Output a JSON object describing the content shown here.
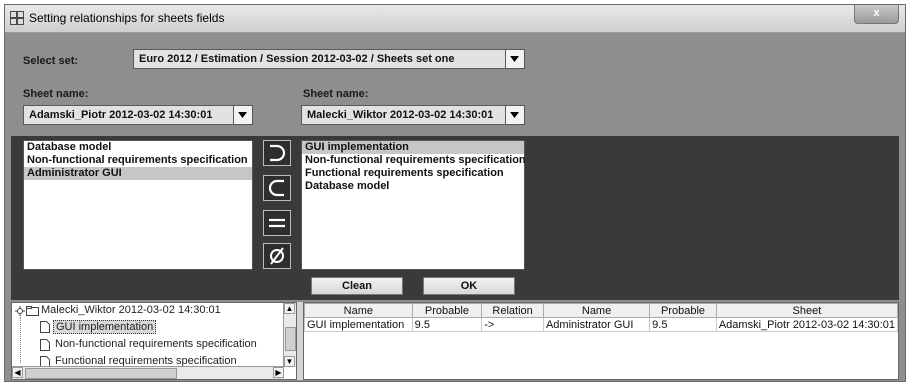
{
  "window": {
    "title": "Setting relationships for sheets fields",
    "close_label": "x"
  },
  "select_set": {
    "label": "Select set:",
    "value": "Euro 2012 / Estimation / Session 2012-03-02 / Sheets set one"
  },
  "left_sheet": {
    "label": "Sheet name:",
    "value": "Adamski_Piotr 2012-03-02 14:30:01"
  },
  "right_sheet": {
    "label": "Sheet name:",
    "value": "Malecki_Wiktor 2012-03-02 14:30:01"
  },
  "left_list": {
    "items": [
      "Database model",
      "Non-functional requirements specification",
      "Administrator GUI"
    ],
    "selected_index": 2
  },
  "right_list": {
    "items": [
      "GUI implementation",
      "Non-functional requirements specification",
      "Functional requirements specification",
      "Database model"
    ],
    "selected_index": 0
  },
  "operators": [
    {
      "name": "superset-button",
      "symbol": "superset"
    },
    {
      "name": "subset-button",
      "symbol": "subset"
    },
    {
      "name": "equal-button",
      "symbol": "equal"
    },
    {
      "name": "empty-set-button",
      "symbol": "empty-set"
    }
  ],
  "buttons": {
    "clean": "Clean",
    "ok": "OK"
  },
  "tree": {
    "root": "Malecki_Wiktor 2012-03-02 14:30:01",
    "children": [
      "GUI implementation",
      "Non-functional requirements specification",
      "Functional requirements specification"
    ],
    "selected_index": 0
  },
  "table": {
    "headers": [
      "Name",
      "Probable",
      "Relation",
      "Name",
      "Probable",
      "Sheet"
    ],
    "rows": [
      [
        "GUI implementation",
        "9.5",
        "->",
        "Administrator GUI",
        "9.5",
        "Adamski_Piotr 2012-03-02 14:30:01"
      ]
    ]
  },
  "colors": {
    "panel_gray": "#8e8e8e",
    "dark_panel": "#3a3a3a",
    "selection": "#c6c6c6"
  }
}
